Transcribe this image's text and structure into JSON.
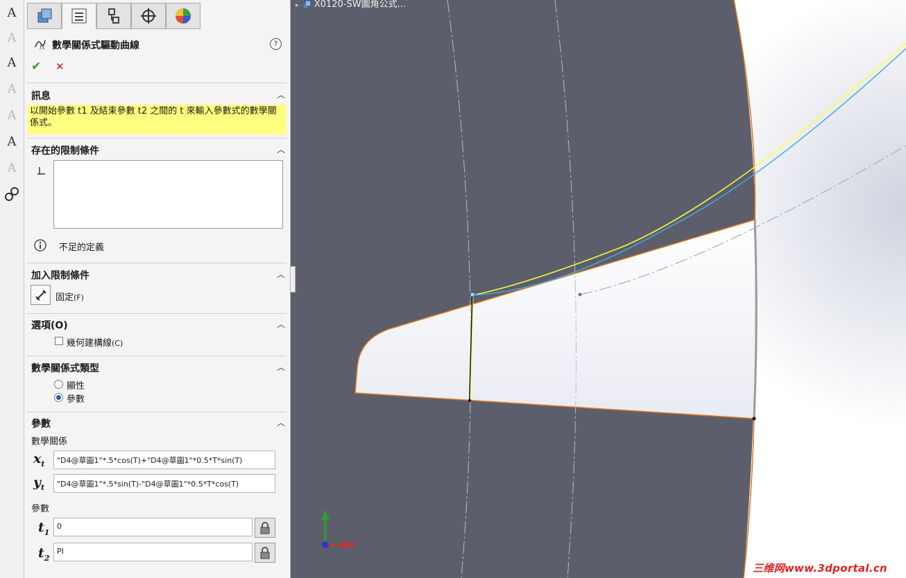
{
  "feature": {
    "title": "數學關係式驅動曲線",
    "help": "?"
  },
  "sections": {
    "message": {
      "title": "訊息",
      "text": "以開始參數 t1 及結束參數 t2 之間的 t 來輸入參數式的數學關係式。"
    },
    "existing": {
      "title": "存在的限制條件",
      "status": "不足的定義"
    },
    "add": {
      "title": "加入限制條件",
      "fix_label": "固定",
      "fix_key": "(F)"
    },
    "options": {
      "title": "選項(O)",
      "construction_label": "幾何建構線",
      "construction_key": "(C)"
    },
    "eqtype": {
      "title": "數學關係式類型",
      "explicit": "顯性",
      "parametric": "參數"
    },
    "params": {
      "title": "參數",
      "equations_label": "數學關係",
      "xt": "\"D4@草圖1\"*.5*cos(T)+\"D4@草圖1\"*0.5*T*sin(T)",
      "yt": "\"D4@草圖1\"*.5*sin(T)-\"D4@草圖1\"*0.5*T*cos(T)",
      "params_label": "參數",
      "t1": "0",
      "t2": "PI"
    }
  },
  "viewport": {
    "tree_item": "X0120-SW圖角公式...",
    "axis_x": "X",
    "axis_y": "Y",
    "watermark": "三维网www.3dportal.cn"
  },
  "colors": {
    "background": "#5c5f6b",
    "highlight": "#ffff7f",
    "curve_yellow": "#ffff33",
    "curve_blue": "#4aa8e0",
    "edge_orange": "#e2761b"
  }
}
